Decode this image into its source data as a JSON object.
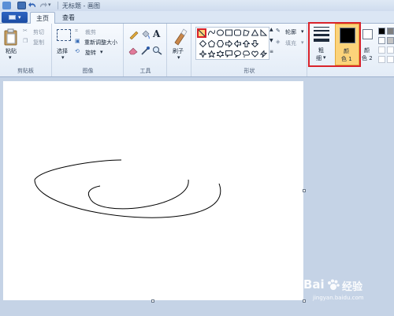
{
  "window": {
    "title": "无标题 - 画图"
  },
  "tabs": [
    {
      "label": "主页",
      "active": true
    },
    {
      "label": "查看",
      "active": false
    }
  ],
  "clipboard": {
    "paste_label": "粘贴",
    "cut_label": "剪切",
    "copy_label": "复制",
    "group_label": "剪贴板"
  },
  "image": {
    "select_label": "选择",
    "crop_label": "裁剪",
    "resize_label": "重新调整大小",
    "rotate_label": "旋转",
    "group_label": "图像"
  },
  "tools": {
    "group_label": "工具"
  },
  "brushes": {
    "label": "刷子"
  },
  "shapes": {
    "outline_label": "轮廓",
    "fill_label": "填充",
    "group_label": "形状"
  },
  "size": {
    "label_line1": "粗",
    "label_line2": "细"
  },
  "colors": {
    "color1_line1": "颜",
    "color1_line2": "色 1",
    "color2_line1": "颜",
    "color2_line2": "色 2",
    "color1_value": "#000000",
    "color2_value": "#ffffff",
    "highlight": "#d9232b",
    "selected_bg": "#fcd37a"
  },
  "watermark": {
    "brand": "Bai",
    "suffix": "经验",
    "domain": "jingyan.baidu.com"
  }
}
